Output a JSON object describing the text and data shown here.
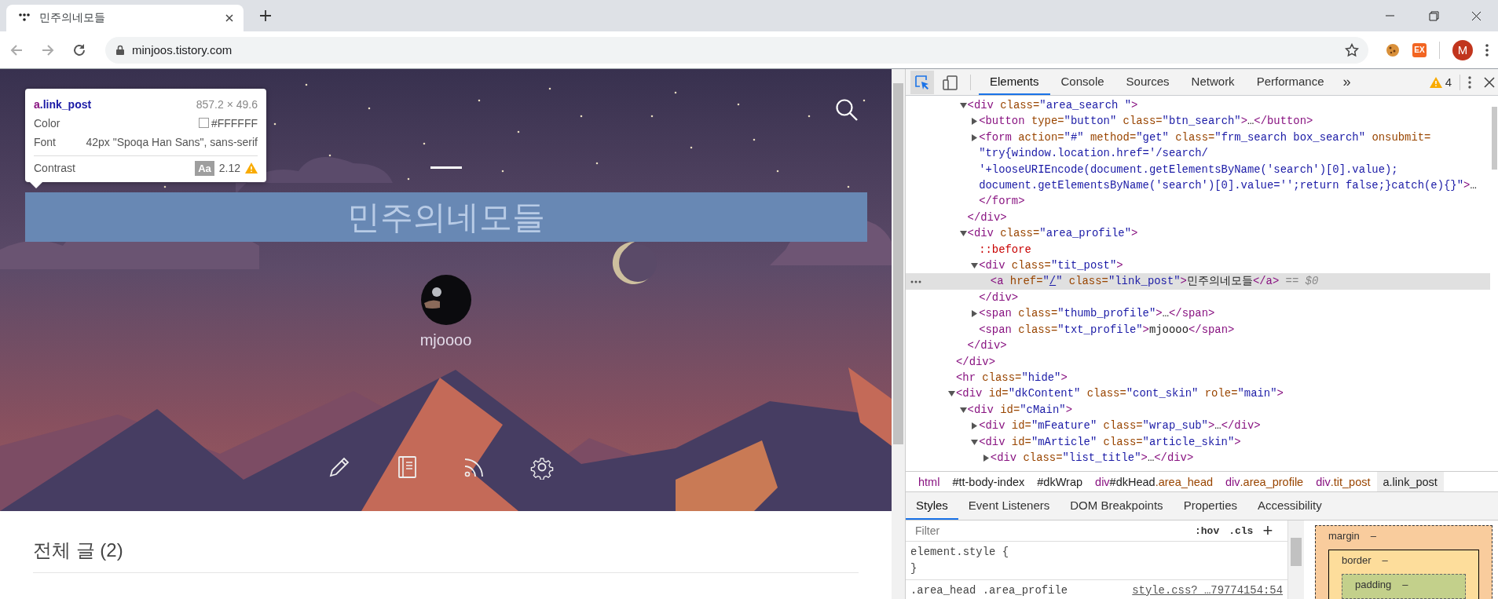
{
  "browser": {
    "tab": {
      "title": "민주의네모들",
      "selected": true
    },
    "url": "minjoos.tistory.com",
    "extension_badge": "EX",
    "profile_initial": "M"
  },
  "page": {
    "header": {
      "title": "민주의네모들",
      "highlighted": true,
      "blog_name": "mjoooo"
    },
    "tooltip": {
      "selector_tag": "a",
      "selector_class": ".link_post",
      "size": "857.2 × 49.6",
      "color_label": "Color",
      "color_value": "#FFFFFF",
      "font_label": "Font",
      "font_value": "42px \"Spoqa Han Sans\", sans-serif",
      "contrast_label": "Contrast",
      "contrast_sample": "Aa",
      "contrast_value": "2.12"
    },
    "section_title": "전체 글 (2)"
  },
  "devtools": {
    "inspect_active": true,
    "tabs": [
      {
        "label": "Elements",
        "selected": true
      },
      {
        "label": "Console",
        "selected": false
      },
      {
        "label": "Sources",
        "selected": false
      },
      {
        "label": "Network",
        "selected": false
      },
      {
        "label": "Performance",
        "selected": false
      }
    ],
    "more": "»",
    "warnings": "4",
    "dom": [
      {
        "children": [
          {
            "selected": false,
            "expanded": true,
            "open": [
              [
                {
                  "kind": "tag",
                  "text": "<div"
                },
                {
                  "kind": "attr",
                  "text": " class="
                },
                {
                  "kind": "val",
                  "text": "\"area_search \""
                },
                {
                  "kind": "tag",
                  "text": ">"
                }
              ]
            ],
            "children": [
              {
                "selected": false,
                "expanded": false,
                "open": [
                  [
                    {
                      "kind": "tag",
                      "text": "<button"
                    },
                    {
                      "kind": "attr",
                      "text": " type="
                    },
                    {
                      "kind": "val",
                      "text": "\"button\""
                    },
                    {
                      "kind": "attr",
                      "text": " class="
                    },
                    {
                      "kind": "val",
                      "text": "\"btn_search\""
                    },
                    {
                      "kind": "tag",
                      "text": ">"
                    },
                    {
                      "kind": "text",
                      "text": "…"
                    },
                    {
                      "kind": "tag",
                      "text": "</button>"
                    }
                  ]
                ]
              },
              {
                "selected": false,
                "expanded": false,
                "open": [
                  [
                    {
                      "kind": "tag",
                      "text": "<form"
                    },
                    {
                      "kind": "attr",
                      "text": " action="
                    },
                    {
                      "kind": "val",
                      "text": "\"#\""
                    },
                    {
                      "kind": "attr",
                      "text": " method="
                    },
                    {
                      "kind": "val",
                      "text": "\"get\""
                    },
                    {
                      "kind": "attr",
                      "text": " class="
                    },
                    {
                      "kind": "val",
                      "text": "\"frm_search box_search\""
                    },
                    {
                      "kind": "attr",
                      "text": " onsubmit="
                    }
                  ],
                  [
                    {
                      "kind": "val",
                      "text": "\"try{window.location.href='/search/"
                    }
                  ],
                  [
                    {
                      "kind": "val",
                      "text": "'+looseURIEncode(document.getElementsByName('search')[0].value);"
                    }
                  ],
                  [
                    {
                      "kind": "val",
                      "text": "document.getElementsByName('search')[0].value='';return false;}catch(e){}\""
                    },
                    {
                      "kind": "tag",
                      "text": ">"
                    },
                    {
                      "kind": "text",
                      "text": "…"
                    }
                  ]
                ],
                "close": [
                  {
                    "kind": "tag",
                    "text": "</form>"
                  }
                ]
              }
            ],
            "close": [
              {
                "kind": "tag",
                "text": "</div>"
              }
            ]
          },
          {
            "selected": false,
            "expanded": true,
            "open": [
              [
                {
                  "kind": "tag",
                  "text": "<div"
                },
                {
                  "kind": "attr",
                  "text": " class="
                },
                {
                  "kind": "val",
                  "text": "\"area_profile\""
                },
                {
                  "kind": "tag",
                  "text": ">"
                }
              ]
            ],
            "children": [
              {
                "selected": false,
                "open": [
                  [
                    {
                      "kind": "pseudo",
                      "text": "::before"
                    }
                  ]
                ]
              },
              {
                "selected": false,
                "expanded": true,
                "open": [
                  [
                    {
                      "kind": "tag",
                      "text": "<div"
                    },
                    {
                      "kind": "attr",
                      "text": " class="
                    },
                    {
                      "kind": "val",
                      "text": "\"tit_post\""
                    },
                    {
                      "kind": "tag",
                      "text": ">"
                    }
                  ]
                ],
                "children": [
                  {
                    "selected": true,
                    "open": [
                      [
                        {
                          "kind": "tag",
                          "text": "<a"
                        },
                        {
                          "kind": "attr",
                          "text": " href="
                        },
                        {
                          "kind": "val",
                          "text": "\""
                        },
                        {
                          "kind": "link",
                          "text": "/"
                        },
                        {
                          "kind": "val",
                          "text": "\""
                        },
                        {
                          "kind": "attr",
                          "text": " class="
                        },
                        {
                          "kind": "val",
                          "text": "\"link_post\""
                        },
                        {
                          "kind": "tag",
                          "text": ">"
                        },
                        {
                          "kind": "text",
                          "text": "민주의네모들"
                        },
                        {
                          "kind": "tag",
                          "text": "</a>"
                        },
                        {
                          "kind": "dim",
                          "text": " == $0"
                        }
                      ]
                    ]
                  }
                ],
                "close": [
                  {
                    "kind": "tag",
                    "text": "</div>"
                  }
                ]
              },
              {
                "selected": false,
                "expanded": false,
                "open": [
                  [
                    {
                      "kind": "tag",
                      "text": "<span"
                    },
                    {
                      "kind": "attr",
                      "text": " class="
                    },
                    {
                      "kind": "val",
                      "text": "\"thumb_profile\""
                    },
                    {
                      "kind": "tag",
                      "text": ">"
                    },
                    {
                      "kind": "text",
                      "text": "…"
                    },
                    {
                      "kind": "tag",
                      "text": "</span>"
                    }
                  ]
                ]
              },
              {
                "selected": false,
                "open": [
                  [
                    {
                      "kind": "tag",
                      "text": "<span"
                    },
                    {
                      "kind": "attr",
                      "text": " class="
                    },
                    {
                      "kind": "val",
                      "text": "\"txt_profile\""
                    },
                    {
                      "kind": "tag",
                      "text": ">"
                    },
                    {
                      "kind": "text",
                      "text": "mjoooo"
                    },
                    {
                      "kind": "tag",
                      "text": "</span>"
                    }
                  ]
                ]
              }
            ],
            "close": [
              {
                "kind": "tag",
                "text": "</div>"
              }
            ]
          }
        ],
        "close": [
          {
            "kind": "tag",
            "text": "</div>"
          }
        ]
      },
      {
        "selected": false,
        "open": [
          [
            {
              "kind": "tag",
              "text": "<hr"
            },
            {
              "kind": "attr",
              "text": " class="
            },
            {
              "kind": "val",
              "text": "\"hide\""
            },
            {
              "kind": "tag",
              "text": ">"
            }
          ]
        ]
      },
      {
        "selected": false,
        "expanded": true,
        "open": [
          [
            {
              "kind": "tag",
              "text": "<div"
            },
            {
              "kind": "attr",
              "text": " id="
            },
            {
              "kind": "val",
              "text": "\"dkContent\""
            },
            {
              "kind": "attr",
              "text": " class="
            },
            {
              "kind": "val",
              "text": "\"cont_skin\""
            },
            {
              "kind": "attr",
              "text": " role="
            },
            {
              "kind": "val",
              "text": "\"main\""
            },
            {
              "kind": "tag",
              "text": ">"
            }
          ]
        ],
        "children": [
          {
            "selected": false,
            "expanded": true,
            "open": [
              [
                {
                  "kind": "tag",
                  "text": "<div"
                },
                {
                  "kind": "attr",
                  "text": " id="
                },
                {
                  "kind": "val",
                  "text": "\"cMain\""
                },
                {
                  "kind": "tag",
                  "text": ">"
                }
              ]
            ],
            "children": [
              {
                "selected": false,
                "expanded": false,
                "open": [
                  [
                    {
                      "kind": "tag",
                      "text": "<div"
                    },
                    {
                      "kind": "attr",
                      "text": " id="
                    },
                    {
                      "kind": "val",
                      "text": "\"mFeature\""
                    },
                    {
                      "kind": "attr",
                      "text": " class="
                    },
                    {
                      "kind": "val",
                      "text": "\"wrap_sub\""
                    },
                    {
                      "kind": "tag",
                      "text": ">"
                    },
                    {
                      "kind": "text",
                      "text": "…"
                    },
                    {
                      "kind": "tag",
                      "text": "</div>"
                    }
                  ]
                ]
              },
              {
                "selected": false,
                "expanded": true,
                "open": [
                  [
                    {
                      "kind": "tag",
                      "text": "<div"
                    },
                    {
                      "kind": "attr",
                      "text": " id="
                    },
                    {
                      "kind": "val",
                      "text": "\"mArticle\""
                    },
                    {
                      "kind": "attr",
                      "text": " class="
                    },
                    {
                      "kind": "val",
                      "text": "\"article_skin\""
                    },
                    {
                      "kind": "tag",
                      "text": ">"
                    }
                  ]
                ],
                "children": [
                  {
                    "selected": false,
                    "expanded": false,
                    "open": [
                      [
                        {
                          "kind": "tag",
                          "text": "<div"
                        },
                        {
                          "kind": "attr",
                          "text": " class="
                        },
                        {
                          "kind": "val",
                          "text": "\"list_title\""
                        },
                        {
                          "kind": "tag",
                          "text": ">"
                        },
                        {
                          "kind": "text",
                          "text": "…"
                        },
                        {
                          "kind": "tag",
                          "text": "</div>"
                        }
                      ]
                    ]
                  }
                ]
              }
            ]
          }
        ]
      }
    ],
    "breadcrumbs": [
      {
        "selected": false,
        "parts": [
          {
            "kind": "tag",
            "text": "html"
          }
        ]
      },
      {
        "selected": false,
        "parts": [
          {
            "kind": "text",
            "text": "#tt-body-index"
          }
        ]
      },
      {
        "selected": false,
        "parts": [
          {
            "kind": "text",
            "text": "#dkWrap"
          }
        ]
      },
      {
        "selected": false,
        "parts": [
          {
            "kind": "tag",
            "text": "div"
          },
          {
            "kind": "text",
            "text": "#dkHead"
          },
          {
            "kind": "attr",
            "text": ".area_head"
          }
        ]
      },
      {
        "selected": false,
        "parts": [
          {
            "kind": "tag",
            "text": "div"
          },
          {
            "kind": "attr",
            "text": ".area_profile"
          }
        ]
      },
      {
        "selected": false,
        "parts": [
          {
            "kind": "tag",
            "text": "div"
          },
          {
            "kind": "attr",
            "text": ".tit_post"
          }
        ]
      },
      {
        "selected": true,
        "parts": [
          {
            "kind": "tag",
            "text": "a"
          },
          {
            "kind": "attr",
            "text": ".link_post"
          }
        ]
      }
    ],
    "sub_tabs": [
      {
        "label": "Styles",
        "selected": true
      },
      {
        "label": "Event Listeners",
        "selected": false
      },
      {
        "label": "DOM Breakpoints",
        "selected": false
      },
      {
        "label": "Properties",
        "selected": false
      },
      {
        "label": "Accessibility",
        "selected": false
      }
    ],
    "styles": {
      "filter_placeholder": "Filter",
      "hov": ":hov",
      "cls": ".cls",
      "add_rule": "+",
      "rules": [
        {
          "lines": [
            "element.style {",
            "}"
          ]
        },
        {
          "lines": [
            ".area_head .area_profile"
          ],
          "source": "style.css?_…79774154:54"
        }
      ]
    },
    "box_model": {
      "label": "margin",
      "value": "–",
      "inner": {
        "label": "border",
        "value": "–",
        "inner": {
          "label": "padding",
          "value": "–"
        }
      }
    }
  }
}
